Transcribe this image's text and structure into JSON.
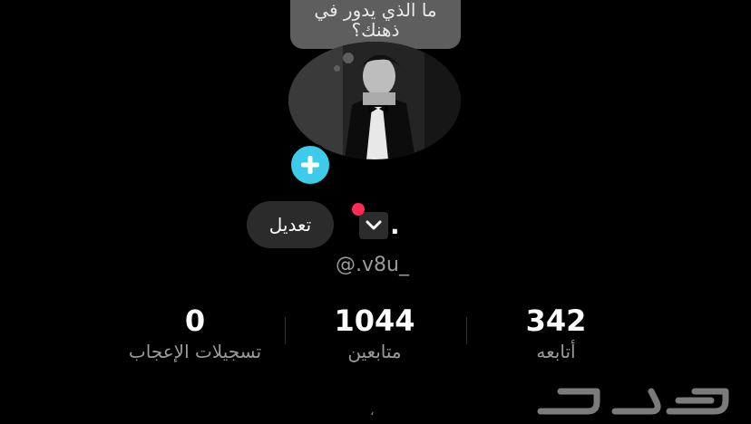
{
  "bubble": {
    "line1": "ما الذي يدور في",
    "line2": "ذهنك؟"
  },
  "profile": {
    "name": ".",
    "handle": "@.v8u_",
    "edit_label": "تعديل"
  },
  "stats": {
    "likes": {
      "value": "0",
      "label": "تسجيلات الإعجاب"
    },
    "followers": {
      "value": "1044",
      "label": "متابعين"
    },
    "following": {
      "value": "342",
      "label": "أتابعه"
    }
  },
  "footer": {
    "mark": "،"
  },
  "colors": {
    "accent": "#3ccbe8",
    "notification": "#fe2c55",
    "background": "#000000"
  },
  "icons": {
    "add": "plus-icon",
    "dropdown": "chevron-down-icon",
    "watermark": "haraj-logo"
  },
  "watermark_text": "حراج"
}
